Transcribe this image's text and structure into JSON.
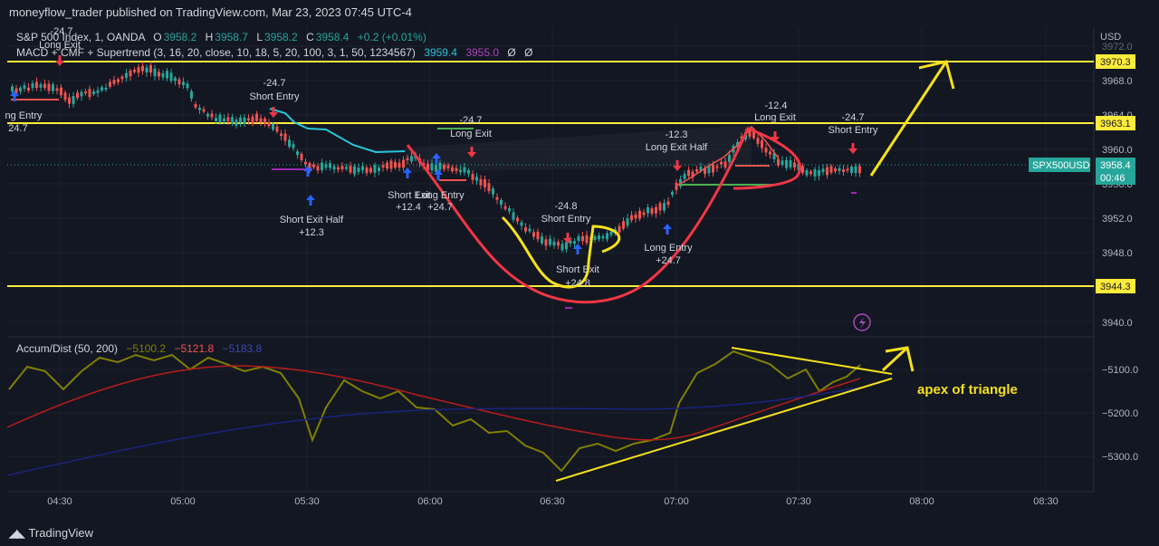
{
  "header": {
    "published": "moneyflow_trader published on TradingView.com, Mar 23, 2023 07:45 UTC-4"
  },
  "legend": {
    "symbol": "S&P 500 Index, 1, OANDA",
    "o_label": "O",
    "o_value": "3958.2",
    "h_label": "H",
    "h_value": "3958.7",
    "l_label": "L",
    "l_value": "3958.2",
    "c_label": "C",
    "c_value": "3958.4",
    "change": "+0.2 (+0.01%)",
    "indicator": "MACD + CMF + Supertrend (3, 16, 20, close, 10, 18, 5, 20, 100, 3, 1, 50, 1234567)",
    "ind_v1": "3959.4",
    "ind_v2": "3955.0",
    "ind_v3": "Ø",
    "ind_v4": "Ø",
    "accum": "Accum/Dist (50, 200)",
    "accum_v1": "−5100.2",
    "accum_v2": "−5121.8",
    "accum_v3": "−5183.8"
  },
  "price_axis": {
    "currency": "USD",
    "ticks": [
      "3972.0",
      "3968.0",
      "3964.0",
      "3960.0",
      "3956.0",
      "3952.0",
      "3948.0",
      "3940.0"
    ],
    "hlines": [
      "3970.3",
      "3963.1",
      "3944.3"
    ],
    "symbol_tag": "SPX500USD",
    "current_price": "3958.4",
    "countdown": "00:46"
  },
  "lower_axis": {
    "ticks": [
      "−5100.0",
      "−5200.0",
      "−5300.0"
    ]
  },
  "time_axis": {
    "ticks": [
      "04:30",
      "05:00",
      "05:30",
      "06:00",
      "06:30",
      "07:00",
      "07:30",
      "08:00",
      "08:30"
    ]
  },
  "signals": [
    {
      "text": "-24.7"
    },
    {
      "text": "Long Exit"
    },
    {
      "text": "ng Entry"
    },
    {
      "text": "24.7"
    },
    {
      "text": "-24.7"
    },
    {
      "text": "Short Entry"
    },
    {
      "text": "Short Exit Half"
    },
    {
      "text": "+12.3"
    },
    {
      "text": "-24.7"
    },
    {
      "text": "Long Exit"
    },
    {
      "text": "Short Exit"
    },
    {
      "text": "Long Entry"
    },
    {
      "text": "+12.4"
    },
    {
      "text": "+24.7"
    },
    {
      "text": "-24.8"
    },
    {
      "text": "Short Entry"
    },
    {
      "text": "Short Exit"
    },
    {
      "text": "+24.8"
    },
    {
      "text": "-12.3"
    },
    {
      "text": "Long Exit Half"
    },
    {
      "text": "Long Entry"
    },
    {
      "text": "+24.7"
    },
    {
      "text": "-12.4"
    },
    {
      "text": "Long Exit"
    },
    {
      "text": "-24.7"
    },
    {
      "text": "Short Entry"
    }
  ],
  "annotation": {
    "apex": "apex of triangle"
  },
  "footer": {
    "brand": "TradingView"
  },
  "colors": {
    "background": "#131722",
    "bull": "#26a69a",
    "bear": "#ef5350",
    "hline": "#ffeb3b",
    "annot_red": "#f23645",
    "annot_yellow": "#f5e11a"
  }
}
